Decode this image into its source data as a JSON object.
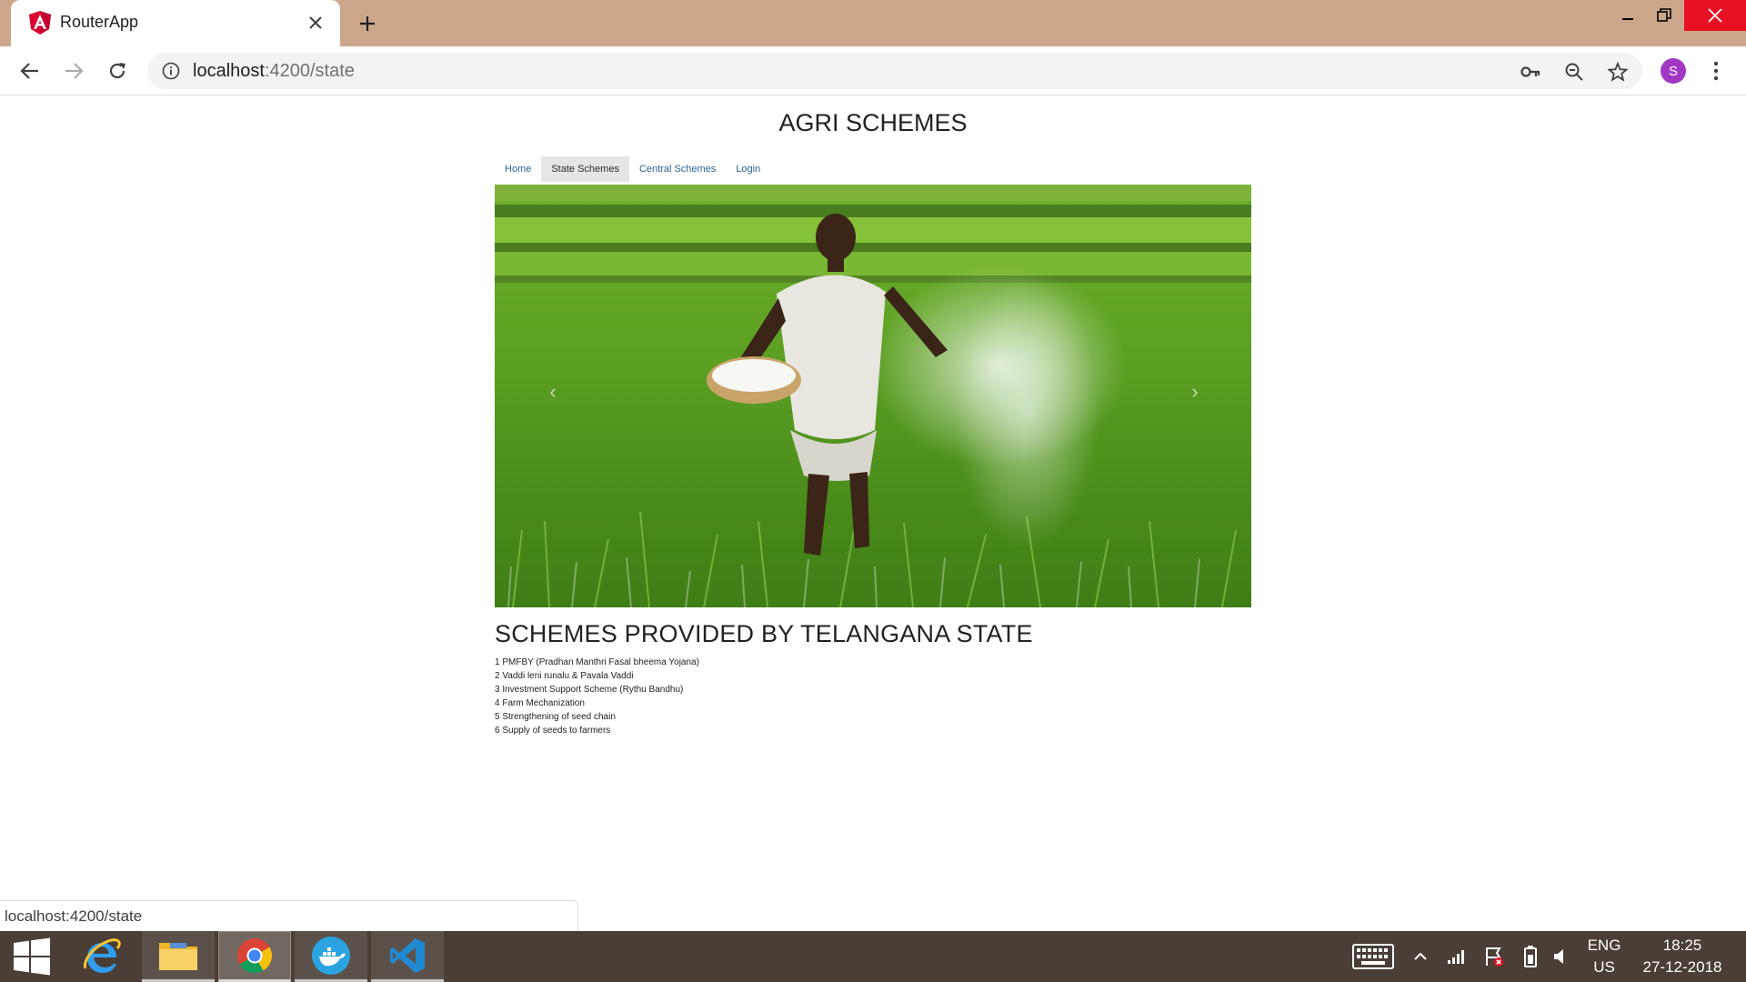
{
  "browser": {
    "tab_title": "RouterApp",
    "url_host": "localhost",
    "url_rest": ":4200/state",
    "avatar_letter": "S",
    "status_url": "localhost:4200/state"
  },
  "page": {
    "title": "AGRI SCHEMES",
    "nav": [
      {
        "label": "Home",
        "active": false
      },
      {
        "label": "State Schemes",
        "active": true
      },
      {
        "label": "Central Schemes",
        "active": false
      },
      {
        "label": "Login",
        "active": false
      }
    ],
    "carousel": {
      "prev": "‹",
      "next": "›"
    },
    "section_heading": "SCHEMES PROVIDED BY TELANGANA STATE",
    "schemes": [
      "1 PMFBY (Pradhan Manthri Fasal bheema Yojana)",
      "2 Vaddi leni runalu & Pavala Vaddi",
      "3 Investment Support Scheme (Rythu Bandhu)",
      "4 Farm Mechanization",
      "5 Strengthening of seed chain",
      "6 Supply of seeds to farmers"
    ]
  },
  "taskbar": {
    "lang_top": "ENG",
    "lang_bottom": "US",
    "time": "18:25",
    "date": "27-12-2018"
  },
  "colors": {
    "titlebar": "#cca68a",
    "link": "#2a6496",
    "taskbar": "#4a3e36",
    "avatar": "#a238c4"
  }
}
